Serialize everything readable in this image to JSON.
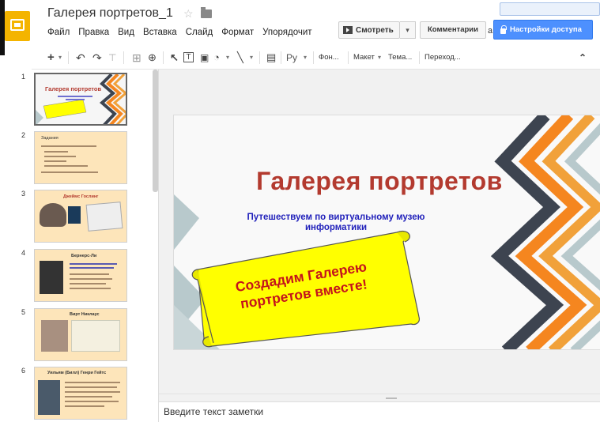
{
  "app": {
    "doc_title": "Галерея портретов_1",
    "star_icon": "☆",
    "menu": [
      "Файл",
      "Правка",
      "Вид",
      "Вставка",
      "Слайд",
      "Формат",
      "Упорядочит"
    ],
    "btn_present": "Смотреть",
    "btn_present_dd": "▾",
    "btn_comments": "Комментарии",
    "a_glyph": "а",
    "btn_share": "Настройки доступа",
    "accent_color": "#4d90fe",
    "logo_color": "#f4b400"
  },
  "toolbar": {
    "plus": "+",
    "dd": "▾",
    "undo": "↶",
    "redo": "↷",
    "paint": "⊤",
    "zoom": "⊕",
    "cursor": "↖",
    "textbox": "T",
    "image": "▣",
    "shape": "◔",
    "line": "╲",
    "comment": "▤",
    "font": "Ру",
    "bg": "Фон...",
    "layout": "Макет",
    "theme": "Тема...",
    "transition": "Переход...",
    "collapse": "⌃"
  },
  "filmstrip": {
    "slides": [
      {
        "n": "1",
        "title": "Галерея портретов"
      },
      {
        "n": "2",
        "title": "Задания"
      },
      {
        "n": "3",
        "title": "Джеймс Гослинг"
      },
      {
        "n": "4",
        "title": "Бернерс-Ли"
      },
      {
        "n": "5",
        "title": "Вирт Никлаус"
      },
      {
        "n": "6",
        "title": "Уильям (Билл) Генри Гейтс"
      }
    ]
  },
  "slide": {
    "title": "Галерея портретов",
    "subtitle_1": "Путешествуем по виртуальному музею",
    "subtitle_2": "информатики",
    "scroll_1": "Создадим Галерею",
    "scroll_2": "портретов вместе!",
    "title_color": "#b33a2f",
    "subtitle_color": "#2222bb",
    "scroll_fill": "#ffff00",
    "scroll_text_color": "#c4131c",
    "stripe_colors": [
      "#3d4450",
      "#f5861f",
      "#f1a13a",
      "#b8c9cc"
    ]
  },
  "notes": {
    "placeholder": "Введите текст заметки"
  }
}
